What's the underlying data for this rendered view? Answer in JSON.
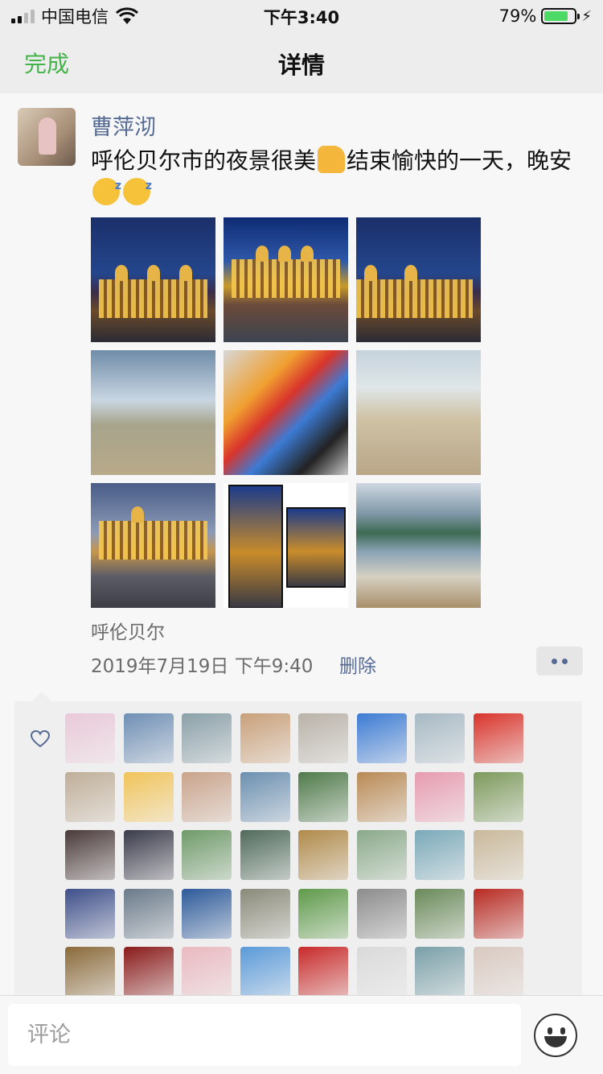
{
  "status_bar": {
    "carrier": "中国电信",
    "time": "下午3:40",
    "battery": "79%",
    "battery_level": 0.79
  },
  "nav": {
    "done": "完成",
    "title": "详情"
  },
  "post": {
    "author": "曹萍沏",
    "text_part1": "呼伦贝尔市的夜景很美",
    "text_part2": "结束愉快的一天，晚安",
    "photos": [
      {
        "icon": "night-palace-photo"
      },
      {
        "icon": "night-palace-photo"
      },
      {
        "icon": "night-palace-photo"
      },
      {
        "icon": "steppe-photo"
      },
      {
        "icon": "kite-photo"
      },
      {
        "icon": "people-photo"
      },
      {
        "icon": "dusk-palace-photo"
      },
      {
        "icon": "collage-photo"
      },
      {
        "icon": "lake-food-photo"
      }
    ],
    "location": "呼伦贝尔",
    "timestamp": "2019年7月19日 下午9:40",
    "delete": "删除"
  },
  "likes": {
    "avatar_colors": [
      "#e9c9d8",
      "#6f8fb5",
      "#8aa0a8",
      "#c9a07a",
      "#b9b2a8",
      "#3c7bd4",
      "#a7b9c4",
      "#d9342b",
      "#bfae98",
      "#f1c45a",
      "#c9a38b",
      "#6b8fb0",
      "#4f7a4a",
      "#b98a55",
      "#e79bb0",
      "#7d9a5c",
      "#4a3a3a",
      "#3a3b4a",
      "#6f9a6a",
      "#4f6a5a",
      "#b08a4a",
      "#8aa98a",
      "#7aa9b9",
      "#c9b89a",
      "#3e4f8a",
      "#6a7a8a",
      "#2d5a9a",
      "#8a8a7a",
      "#5f9a4a",
      "#8c8c8c",
      "#6a8a5a",
      "#b82a22",
      "#8a6a3a",
      "#8a1a1a",
      "#e9b9c0",
      "#5a9ad9",
      "#c92a2a",
      "#dadada",
      "#7aa0a8",
      "#d9c9c0"
    ]
  },
  "comment": {
    "placeholder": "评论"
  }
}
